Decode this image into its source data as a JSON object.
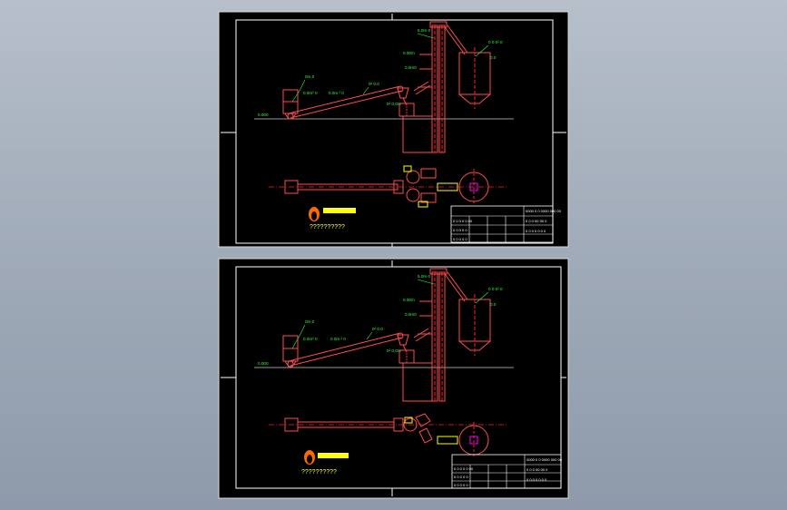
{
  "viewer": {
    "background": "#9aa5b4"
  },
  "colors": {
    "sheet": "#000000",
    "frame": "#ffffff",
    "equipment": "#ff4d4d",
    "annotation": "#33ff33",
    "centerline": "#ff2222",
    "highlight": "#ffff00",
    "hatch": "#ff00ff"
  },
  "sheets": [
    {
      "name": "sheet-top",
      "labels": {
        "ground": "0.000",
        "hopper": "0m,0",
        "feeder": "0.0m² 0",
        "belt": "0.0m ² 0",
        "belt_top": "0² 0.0",
        "tower_top": "5.0m 0",
        "tower_mid": "0.00m",
        "tower_low": "0.0m0",
        "crusher": "0² 0,0m",
        "silo": "0 0 0² 0",
        "silo_sub": "0.0"
      },
      "logo_text": "??????????",
      "title_block": {
        "header": "0000 0 0 0000 000 00",
        "row1": "0 0 0 0 0 00",
        "row2": "0 0 0 0 0",
        "row3": "0 0 0 0 0",
        "right1": "0 0 0 00 00 0",
        "right2": "0 0 0 0 0 0 0"
      }
    },
    {
      "name": "sheet-bottom",
      "labels": {
        "ground": "0.000",
        "hopper": "0m,0",
        "feeder": "0.0m² 0",
        "belt": "0.0m ² 0",
        "belt_top": "0² 0.0",
        "tower_top": "5.0m 0",
        "tower_mid": "0.00m",
        "tower_low": "0.0m0",
        "crusher": "0² 0,0m",
        "silo": "0 0 0² 0",
        "silo_sub": "0.0"
      },
      "logo_text": "??????????",
      "title_block": {
        "header": "0000 0 0 0000 000 00",
        "row1": "0 0 0 0 0 00",
        "row2": "0 0 0 0 0",
        "row3": "0 0 0 0 0",
        "right1": "0 0 0 00 00 0",
        "right2": "0 0 0 0 0 0 0"
      }
    }
  ]
}
